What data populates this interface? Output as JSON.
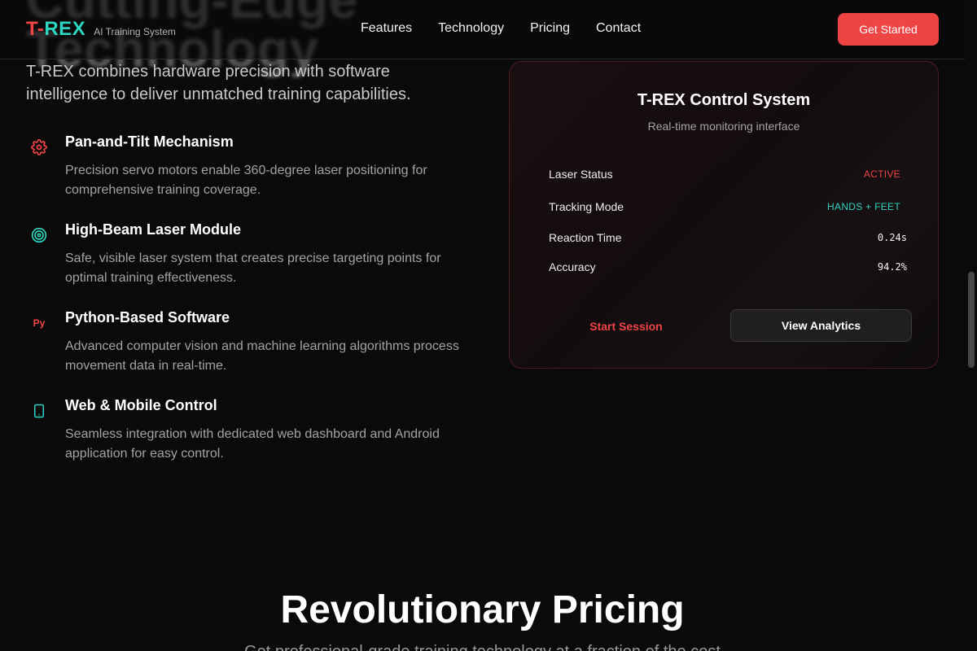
{
  "background_heading": "Cutting-Edge\nTechnology",
  "nav": {
    "logo_prefix": "T-",
    "logo_suffix": "REX",
    "logo_tagline": "AI Training System",
    "links": [
      "Features",
      "Technology",
      "Pricing",
      "Contact"
    ],
    "cta_label": "Get Started"
  },
  "intro": "T-REX combines hardware precision with software intelligence to deliver unmatched training capabilities.",
  "features": [
    {
      "icon": "gear-icon",
      "title": "Pan-and-Tilt Mechanism",
      "description": "Precision servo motors enable 360-degree laser positioning for comprehensive training coverage."
    },
    {
      "icon": "target-icon",
      "title": "High-Beam Laser Module",
      "description": "Safe, visible laser system that creates precise targeting points for optimal training effectiveness."
    },
    {
      "icon": "python-icon",
      "icon_text": "Py",
      "title": "Python-Based Software",
      "description": "Advanced computer vision and machine learning algorithms process movement data in real-time."
    },
    {
      "icon": "smartphone-icon",
      "title": "Web & Mobile Control",
      "description": "Seamless integration with dedicated web dashboard and Android application for easy control."
    }
  ],
  "panel": {
    "title": "T-REX Control System",
    "subtitle": "Real-time monitoring interface",
    "stats": [
      {
        "label": "Laser Status",
        "value": "ACTIVE"
      },
      {
        "label": "Tracking Mode",
        "value": "HANDS + FEET"
      },
      {
        "label": "Reaction Time",
        "value": "0.24s"
      },
      {
        "label": "Accuracy",
        "value": "94.2%"
      }
    ],
    "start_label": "Start Session",
    "analytics_label": "View Analytics"
  },
  "pricing": {
    "title": "Revolutionary Pricing",
    "subtitle": "Get professional-grade training technology at a fraction of the cost"
  },
  "colors": {
    "accent_red": "#ef4444",
    "accent_teal": "#2dd4bf",
    "background": "#0b0a0b"
  }
}
